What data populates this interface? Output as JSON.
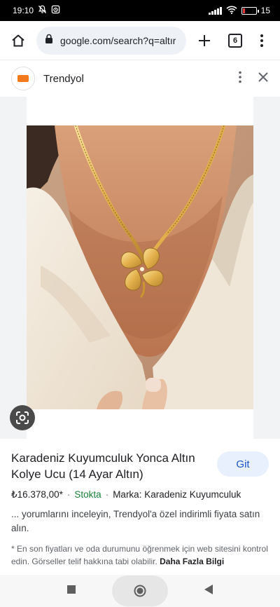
{
  "status_bar": {
    "time": "19:10",
    "battery": "15",
    "battery_level": 0.15,
    "icons": [
      "mute-icon",
      "alarm-icon",
      "signal-icon",
      "wifi-icon",
      "battery-icon"
    ]
  },
  "browser": {
    "url": "google.com/search?q=altır",
    "tab_count": "6",
    "icons": [
      "home-icon",
      "lock-icon",
      "plus-icon",
      "tabs-icon",
      "more-vert-icon"
    ]
  },
  "sheet": {
    "site_name": "Trendyol",
    "icons": [
      "more-vert-icon",
      "close-icon"
    ]
  },
  "product": {
    "title": "Karadeniz Kuyumculuk Yonca Altın Kolye Ucu (14 Ayar Altın)",
    "go_label": "Git",
    "price": "₺16.378,00*",
    "stock": "Stokta",
    "brand": "Marka: Karadeniz Kuyumculuk",
    "description": "... yorumlarını inceleyin, Trendyol'a özel indirimli fiyata satın alın.",
    "footnote": "* En son fiyatları ve oda durumunu öğrenmek için web sitesini kontrol edin. Görseller telif hakkına tabi olabilir.",
    "more_info": "Daha Fazla Bilgi"
  },
  "colors": {
    "accent": "#1a56c7",
    "stock": "#188038",
    "brand": "#f27a1a"
  }
}
